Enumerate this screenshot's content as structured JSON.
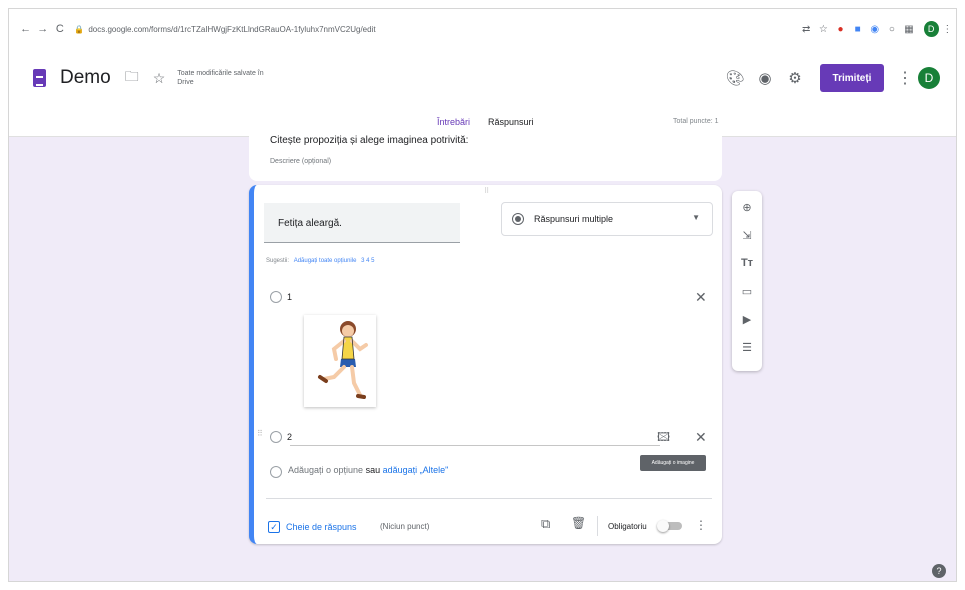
{
  "browser": {
    "url": "docs.google.com/forms/d/1rcTZaIHWgjFzKtLlndGRauOA-1fyluhx7nmVC2Ug/edit",
    "profile_initial": "D"
  },
  "header": {
    "title": "Demo",
    "save_status": "Toate modificările salvate în Drive",
    "send_label": "Trimiteți",
    "avatar_initial": "D",
    "accent_color": "#673ab7"
  },
  "tabs": [
    {
      "label": "Întrebări",
      "active": true
    },
    {
      "label": "Răspunsuri",
      "active": false
    }
  ],
  "total_points": "Total puncte: 1",
  "description_card": {
    "title": "Citește propoziția și alege imaginea potrivită:",
    "subtitle": "Descriere (opțional)"
  },
  "question": {
    "title": "Fetița aleargă.",
    "type": "Răspunsuri multiple",
    "suggestions_label": "Sugestii:",
    "suggestions_link": "Adăugați toate opțiunile",
    "suggestions_values": "3   4   5",
    "options": [
      {
        "label": "1",
        "image": "running-girl"
      },
      {
        "label": "2"
      }
    ],
    "image_tooltip": "Adăugați o imagine",
    "add_option": "Adăugați o opțiune",
    "add_option_sep": "sau",
    "add_other": "adăugați „Altele\"",
    "answer_key": "Cheie de răspuns",
    "answer_points": "(Niciun punct)",
    "required_label": "Obligatoriu",
    "required_on": false
  },
  "toolbar_icons": [
    "add-question-icon",
    "import-questions-icon",
    "add-title-icon",
    "add-image-icon",
    "add-video-icon",
    "add-section-icon"
  ]
}
